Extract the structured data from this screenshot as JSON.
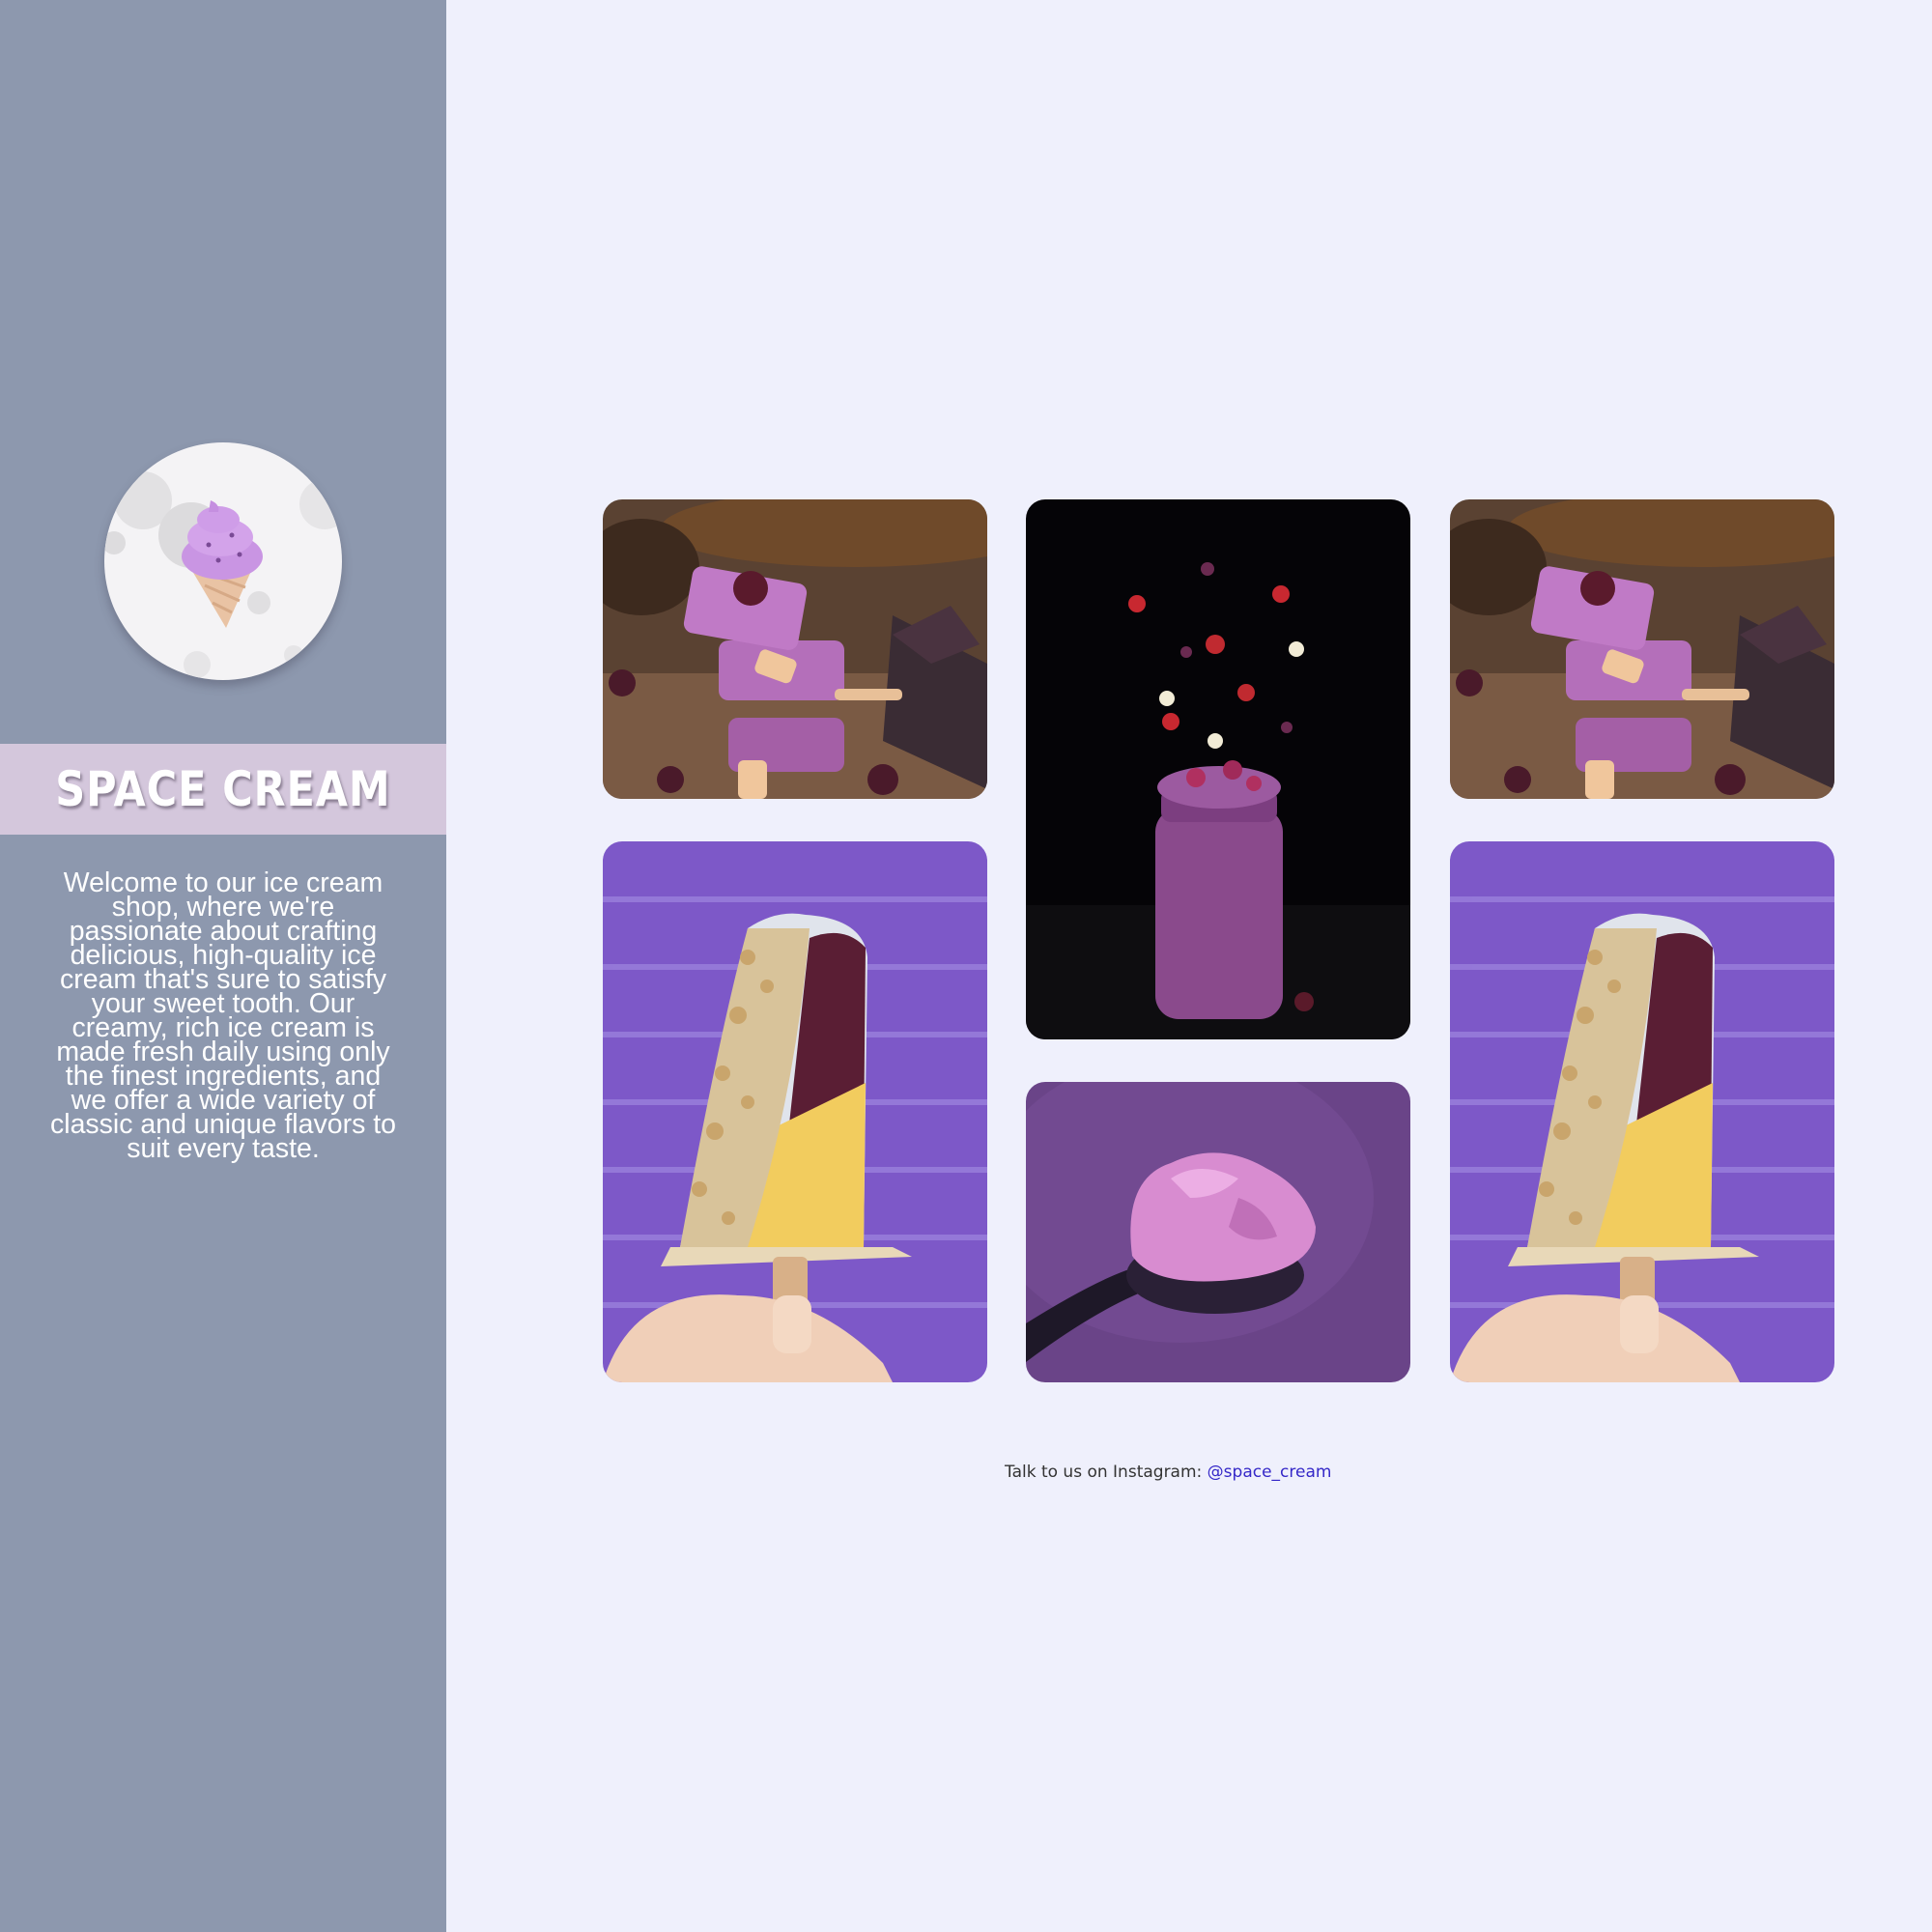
{
  "brand": {
    "name": "SPACE CREAM",
    "intro": "Welcome to our ice cream shop, where we're passionate about crafting delicious, high-quality ice cream that's sure to satisfy your sweet tooth. Our creamy, rich ice cream is made fresh daily using only the finest ingredients, and we offer a wide variety of classic and unique flavors to suit every taste."
  },
  "gallery": {
    "photos": [
      "stacked-popsicles-photo",
      "berry-smoothie-jar-photo",
      "stacked-popsicles-photo",
      "nut-popsicle-photo",
      "ice-cream-scoop-photo",
      "nut-popsicle-photo"
    ]
  },
  "footer": {
    "prefix": "Talk to us on Instagram: ",
    "handle": "@space_cream"
  },
  "colors": {
    "sidebar": "#8d98ae",
    "page": "#eff0fc",
    "band": "#d4c7dc",
    "link": "#3528c8"
  }
}
